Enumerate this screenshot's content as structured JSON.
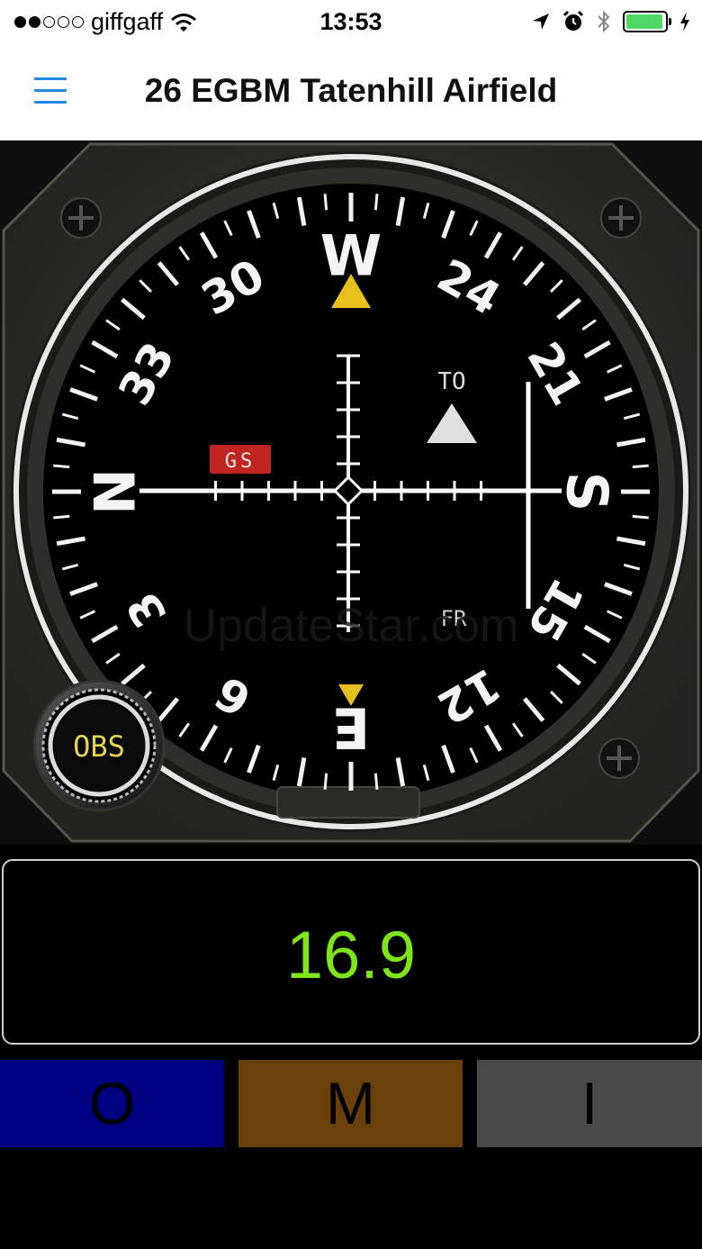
{
  "status": {
    "carrier": "giffgaff",
    "time": "13:53",
    "signal_bars_filled": 2,
    "signal_bars_total": 5,
    "battery_level": 0.95
  },
  "nav": {
    "title": "26 EGBM Tatenhill Airfield",
    "menu_icon": "hamburger-menu-icon"
  },
  "instrument": {
    "heading_labels": [
      "W",
      "24",
      "21",
      "S",
      "15",
      "12",
      "E",
      "6",
      "3",
      "N",
      "33",
      "30"
    ],
    "to_label": "TO",
    "from_label": "FR",
    "gs_flag": "GS",
    "obs_knob_label": "OBS",
    "watermark": "UpdateStar.com",
    "colors": {
      "pointer": "#e8c01c",
      "gs_flag": "#c0261f",
      "to_flag": "#e0e0e0",
      "obs_text": "#e6d44a"
    }
  },
  "readout": {
    "value": "16.9",
    "color": "#7ee51a"
  },
  "marker_buttons": [
    {
      "label": "O",
      "color": "#000083"
    },
    {
      "label": "M",
      "color": "#694009"
    },
    {
      "label": "I",
      "color": "#4a4a4a"
    }
  ]
}
